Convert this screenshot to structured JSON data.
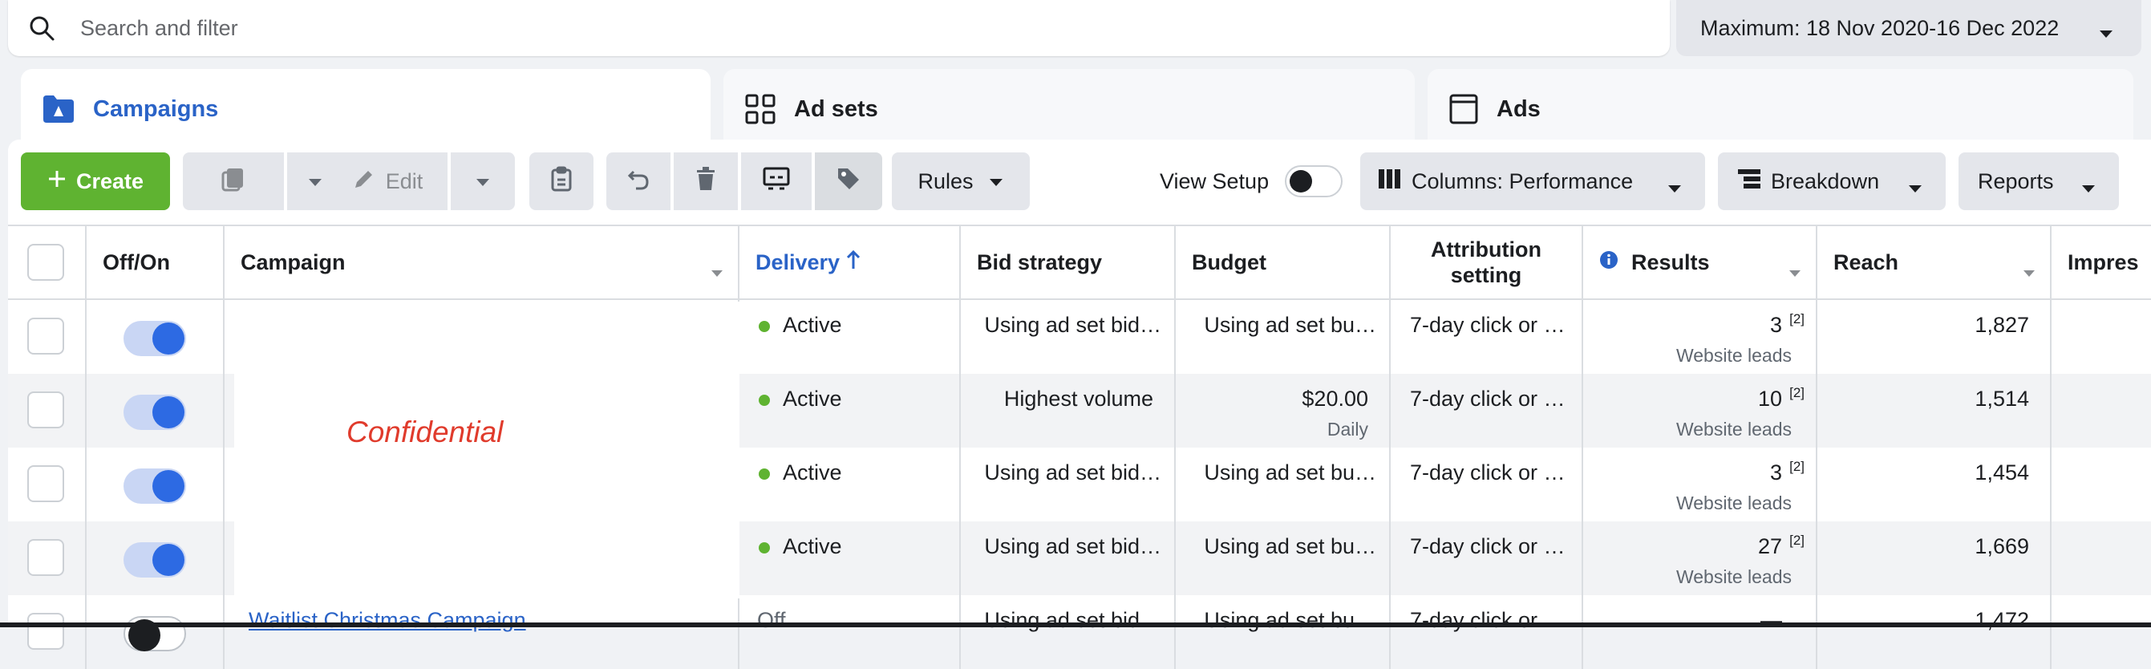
{
  "search": {
    "placeholder": "Search and filter"
  },
  "date_range": {
    "label": "Maximum: 18 Nov 2020-16 Dec 2022"
  },
  "tabs": [
    {
      "label": "Campaigns",
      "icon": "folder-icon"
    },
    {
      "label": "Ad sets",
      "icon": "grid-icon"
    },
    {
      "label": "Ads",
      "icon": "ad-frame-icon"
    }
  ],
  "toolbar": {
    "create_label": "Create",
    "edit_label": "Edit",
    "rules_label": "Rules",
    "view_setup_label": "View Setup",
    "columns_label": "Columns: Performance",
    "breakdown_label": "Breakdown",
    "reports_label": "Reports"
  },
  "table": {
    "headers": {
      "off_on": "Off/On",
      "campaign": "Campaign",
      "delivery": "Delivery",
      "bid_strategy": "Bid strategy",
      "budget": "Budget",
      "attribution_line1": "Attribution",
      "attribution_line2": "setting",
      "results": "Results",
      "reach": "Reach",
      "impressions": "Impres"
    },
    "rows": [
      {
        "delivery": "Active",
        "bid": "Using ad set bid…",
        "budget": "Using ad set bu…",
        "budget_sub": "",
        "attribution": "7-day click or …",
        "results": "3",
        "results_note": "[2]",
        "results_sub": "Website leads",
        "reach": "1,827"
      },
      {
        "delivery": "Active",
        "bid": "Highest volume",
        "budget": "$20.00",
        "budget_sub": "Daily",
        "attribution": "7-day click or …",
        "results": "10",
        "results_note": "[2]",
        "results_sub": "Website leads",
        "reach": "1,514"
      },
      {
        "delivery": "Active",
        "bid": "Using ad set bid…",
        "budget": "Using ad set bu…",
        "budget_sub": "",
        "attribution": "7-day click or …",
        "results": "3",
        "results_note": "[2]",
        "results_sub": "Website leads",
        "reach": "1,454"
      },
      {
        "delivery": "Active",
        "bid": "Using ad set bid…",
        "budget": "Using ad set bu…",
        "budget_sub": "",
        "attribution": "7-day click or …",
        "results": "27",
        "results_note": "[2]",
        "results_sub": "Website leads",
        "reach": "1,669"
      },
      {
        "delivery": "Off",
        "bid": "Using ad set bid…",
        "budget": "Using ad set bu…",
        "budget_sub": "",
        "attribution": "7-day click or …",
        "results": "—",
        "results_note": "",
        "results_sub": "",
        "reach": "1,472",
        "campaign": "Waitlist Christmas Campaign"
      }
    ]
  },
  "redaction_label": "Confidential",
  "colors": {
    "accent": "#2a63c7",
    "create_green": "#5fb331",
    "active_dot": "#5fb331",
    "redaction_text": "#e03b2c"
  }
}
